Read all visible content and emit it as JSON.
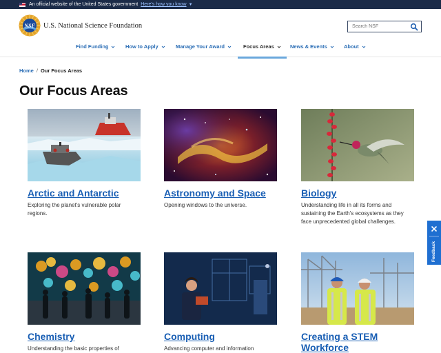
{
  "gov_banner": {
    "text": "An official website of the United States government",
    "link": "Here's how you know"
  },
  "header": {
    "site_name": "U.S. National Science Foundation",
    "logo_text": "NSF",
    "search_placeholder": "Search NSF"
  },
  "nav": {
    "items": [
      {
        "label": "Find Funding"
      },
      {
        "label": "How to Apply"
      },
      {
        "label": "Manage Your Award"
      },
      {
        "label": "Focus Areas"
      },
      {
        "label": "News & Events"
      },
      {
        "label": "About"
      }
    ],
    "active": "Focus Areas",
    "accent": "#6aa7dc"
  },
  "breadcrumb": {
    "home": "Home",
    "separator": "/",
    "current": "Our Focus Areas"
  },
  "page_title": "Our Focus Areas",
  "cards": [
    {
      "title": "Arctic and Antarctic",
      "description": "Exploring the planet's vulnerable polar regions.",
      "image": "polar-icebreaker-photo"
    },
    {
      "title": "Astronomy and Space",
      "description": "Opening windows to the universe.",
      "image": "nebula-photo"
    },
    {
      "title": "Biology",
      "description": "Understanding life in all its forms and sustaining the Earth's ecosystems as they face unprecedented global challenges.",
      "image": "hummingbird-photo"
    },
    {
      "title": "Chemistry",
      "description": "Understanding the basic properties of",
      "image": "molecule-visualization-photo"
    },
    {
      "title": "Computing",
      "description": "Advancing computer and information",
      "image": "robot-lab-photo"
    },
    {
      "title": "Creating a STEM Workforce",
      "description": "",
      "image": "construction-workers-photo"
    }
  ],
  "feedback": {
    "label": "Feedback"
  },
  "colors": {
    "banner_bg": "#1b2b48",
    "link_blue": "#1a5fb4",
    "feedback_bg": "#1f6fd1"
  }
}
